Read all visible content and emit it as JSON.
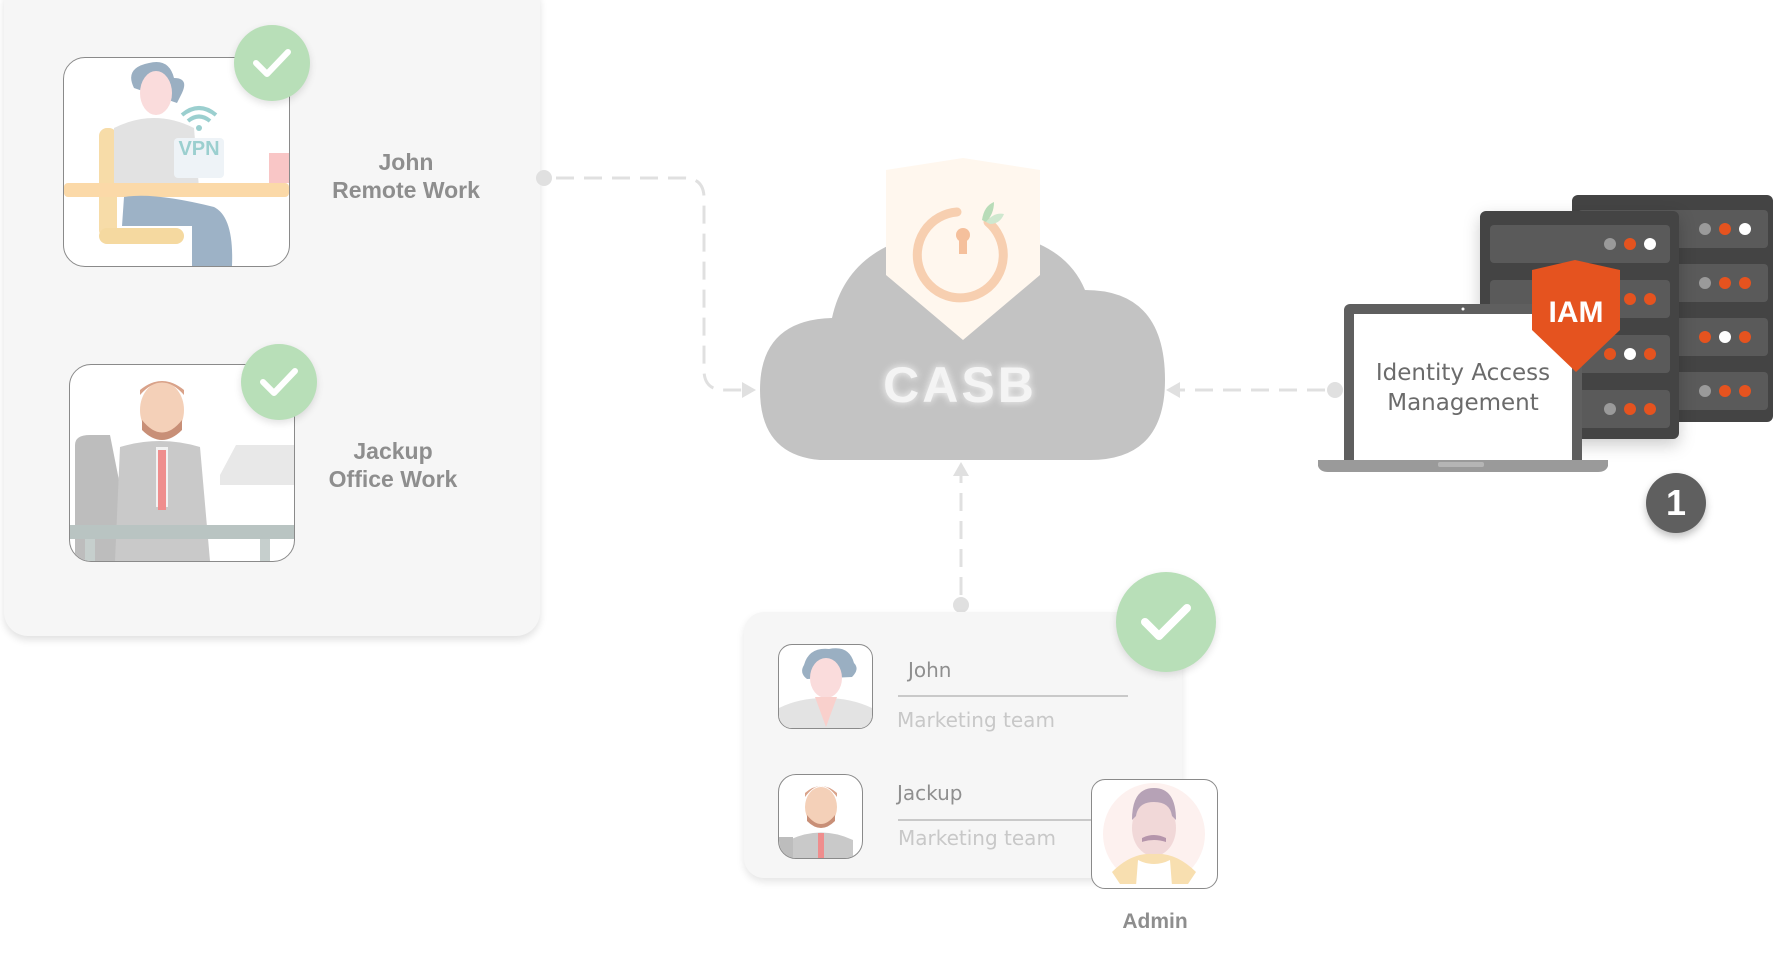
{
  "users": [
    {
      "name": "John",
      "mode": "Remote Work",
      "verified": true,
      "vpn_label": "VPN"
    },
    {
      "name": "Jackup",
      "mode": "Office Work",
      "verified": true
    }
  ],
  "casb": {
    "label": "CASB"
  },
  "iam": {
    "shield_label": "IAM",
    "screen_line1": "Identity Access",
    "screen_line2": "Management",
    "step_badge": "1"
  },
  "directory": {
    "verified": true,
    "entries": [
      {
        "name": "John",
        "team": "Marketing team"
      },
      {
        "name": "Jackup",
        "team": "Marketing team"
      }
    ],
    "admin_label": "Admin"
  },
  "colors": {
    "check_green": "#b8dfb8",
    "iam_orange": "#e5531f",
    "cloud_gray": "#c3c3c3",
    "server_dark": "#444444"
  }
}
